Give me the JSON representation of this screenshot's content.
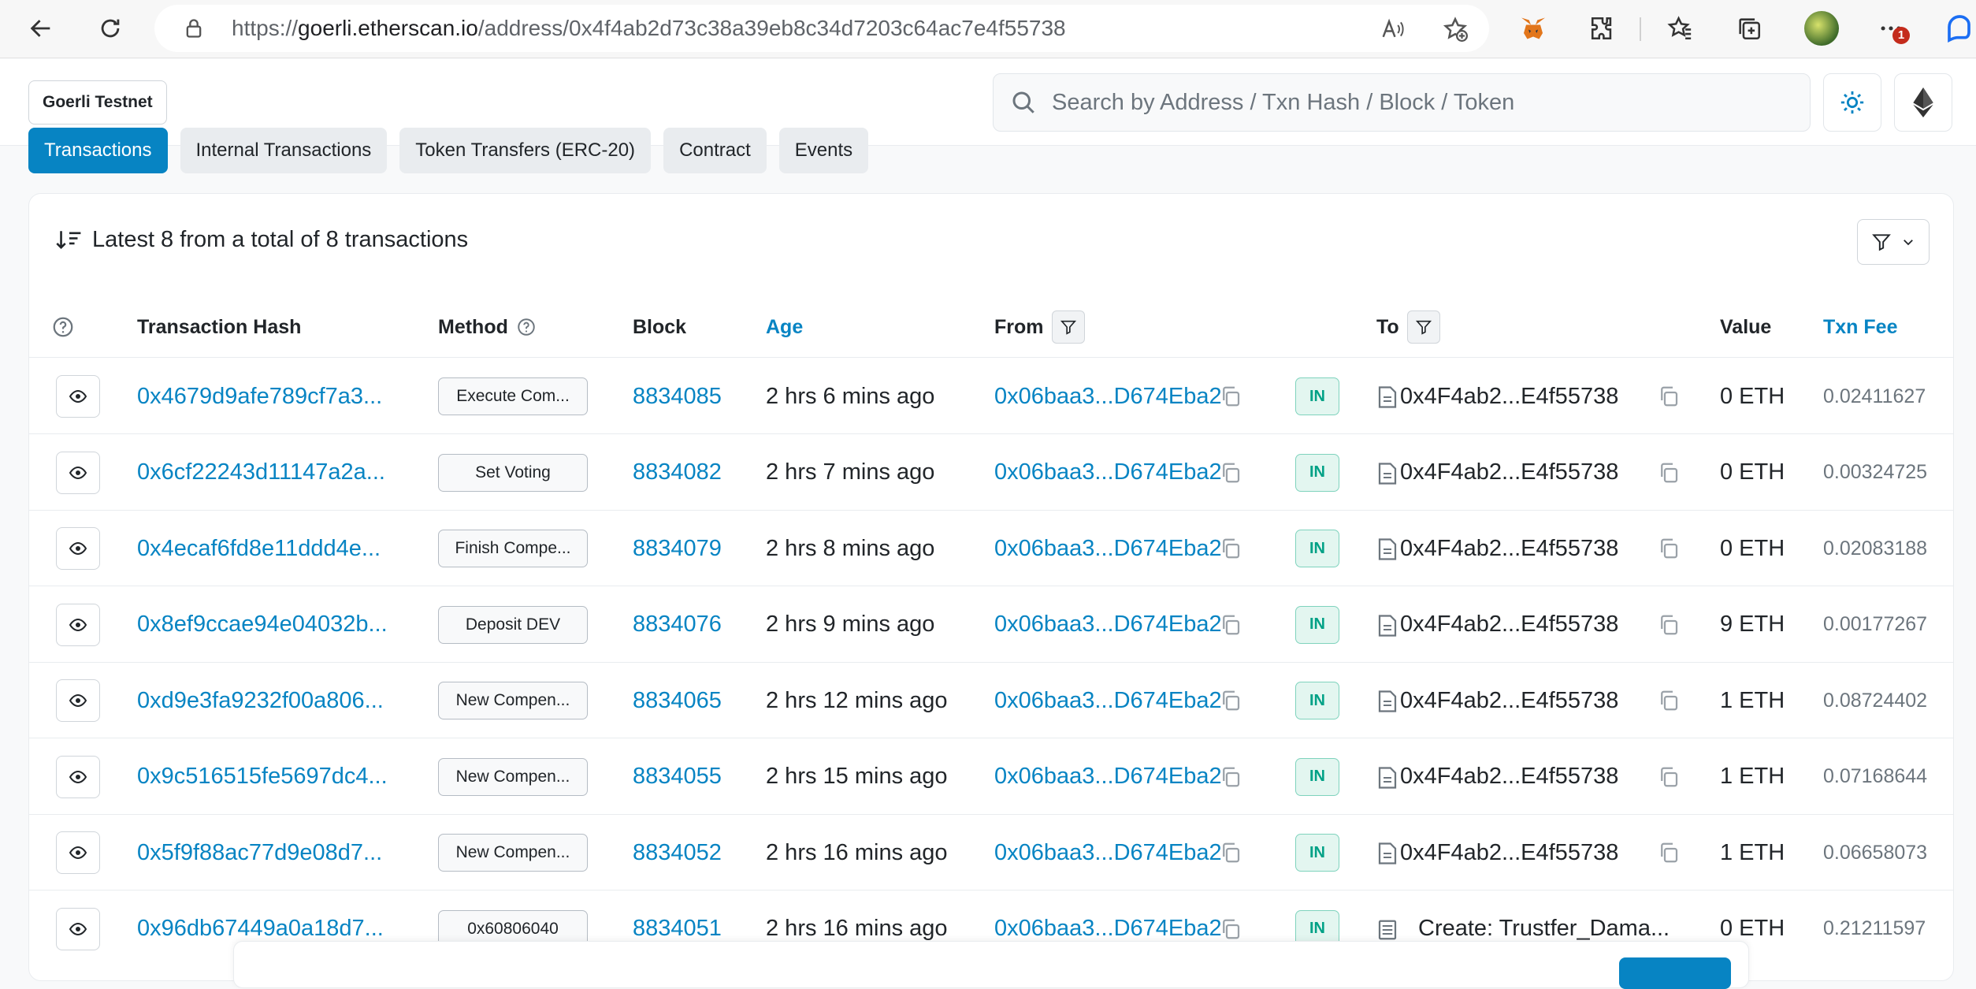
{
  "browser": {
    "url_prefix": "https://",
    "url_host": "goerli.etherscan.io",
    "url_path": "/address/0x4f4ab2d73c38a39eb8c34d7203c64ac7e4f55738",
    "notification_badge": "1"
  },
  "header": {
    "network_label": "Goerli Testnet",
    "search_placeholder": "Search by Address / Txn Hash / Block / Token"
  },
  "tabs": [
    {
      "label": "Transactions",
      "active": true
    },
    {
      "label": "Internal Transactions",
      "active": false
    },
    {
      "label": "Token Transfers (ERC-20)",
      "active": false
    },
    {
      "label": "Contract",
      "active": false
    },
    {
      "label": "Events",
      "active": false
    }
  ],
  "summary": "Latest 8 from a total of 8 transactions",
  "columns": {
    "hash": "Transaction Hash",
    "method": "Method",
    "block": "Block",
    "age": "Age",
    "from": "From",
    "to": "To",
    "value": "Value",
    "fee": "Txn Fee"
  },
  "transactions": [
    {
      "hash": "0x4679d9afe789cf7a3...",
      "method": "Execute Com...",
      "block": "8834085",
      "age": "2 hrs 6 mins ago",
      "from": "0x06baa3...D674Eba2",
      "direction": "IN",
      "to": "0x4F4ab2...E4f55738",
      "value": "0 ETH",
      "fee": "0.02411627"
    },
    {
      "hash": "0x6cf22243d11147a2a...",
      "method": "Set Voting",
      "block": "8834082",
      "age": "2 hrs 7 mins ago",
      "from": "0x06baa3...D674Eba2",
      "direction": "IN",
      "to": "0x4F4ab2...E4f55738",
      "value": "0 ETH",
      "fee": "0.00324725"
    },
    {
      "hash": "0x4ecaf6fd8e11ddd4e...",
      "method": "Finish Compe...",
      "block": "8834079",
      "age": "2 hrs 8 mins ago",
      "from": "0x06baa3...D674Eba2",
      "direction": "IN",
      "to": "0x4F4ab2...E4f55738",
      "value": "0 ETH",
      "fee": "0.02083188"
    },
    {
      "hash": "0x8ef9ccae94e04032b...",
      "method": "Deposit DEV",
      "block": "8834076",
      "age": "2 hrs 9 mins ago",
      "from": "0x06baa3...D674Eba2",
      "direction": "IN",
      "to": "0x4F4ab2...E4f55738",
      "value": "9 ETH",
      "fee": "0.00177267"
    },
    {
      "hash": "0xd9e3fa9232f00a806...",
      "method": "New Compen...",
      "block": "8834065",
      "age": "2 hrs 12 mins ago",
      "from": "0x06baa3...D674Eba2",
      "direction": "IN",
      "to": "0x4F4ab2...E4f55738",
      "value": "1 ETH",
      "fee": "0.08724402"
    },
    {
      "hash": "0x9c516515fe5697dc4...",
      "method": "New Compen...",
      "block": "8834055",
      "age": "2 hrs 15 mins ago",
      "from": "0x06baa3...D674Eba2",
      "direction": "IN",
      "to": "0x4F4ab2...E4f55738",
      "value": "1 ETH",
      "fee": "0.07168644"
    },
    {
      "hash": "0x5f9f88ac77d9e08d7...",
      "method": "New Compen...",
      "block": "8834052",
      "age": "2 hrs 16 mins ago",
      "from": "0x06baa3...D674Eba2",
      "direction": "IN",
      "to": "0x4F4ab2...E4f55738",
      "value": "1 ETH",
      "fee": "0.06658073"
    },
    {
      "hash": "0x96db67449a0a18d7...",
      "method": "0x60806040",
      "block": "8834051",
      "age": "2 hrs 16 mins ago",
      "from": "0x06baa3...D674Eba2",
      "direction": "IN",
      "to": "Create: Trustfer_Dama...",
      "to_is_create": true,
      "value": "0 ETH",
      "fee": "0.21211597"
    }
  ],
  "colors": {
    "link": "#0784c3",
    "in_badge": "#00a186"
  }
}
